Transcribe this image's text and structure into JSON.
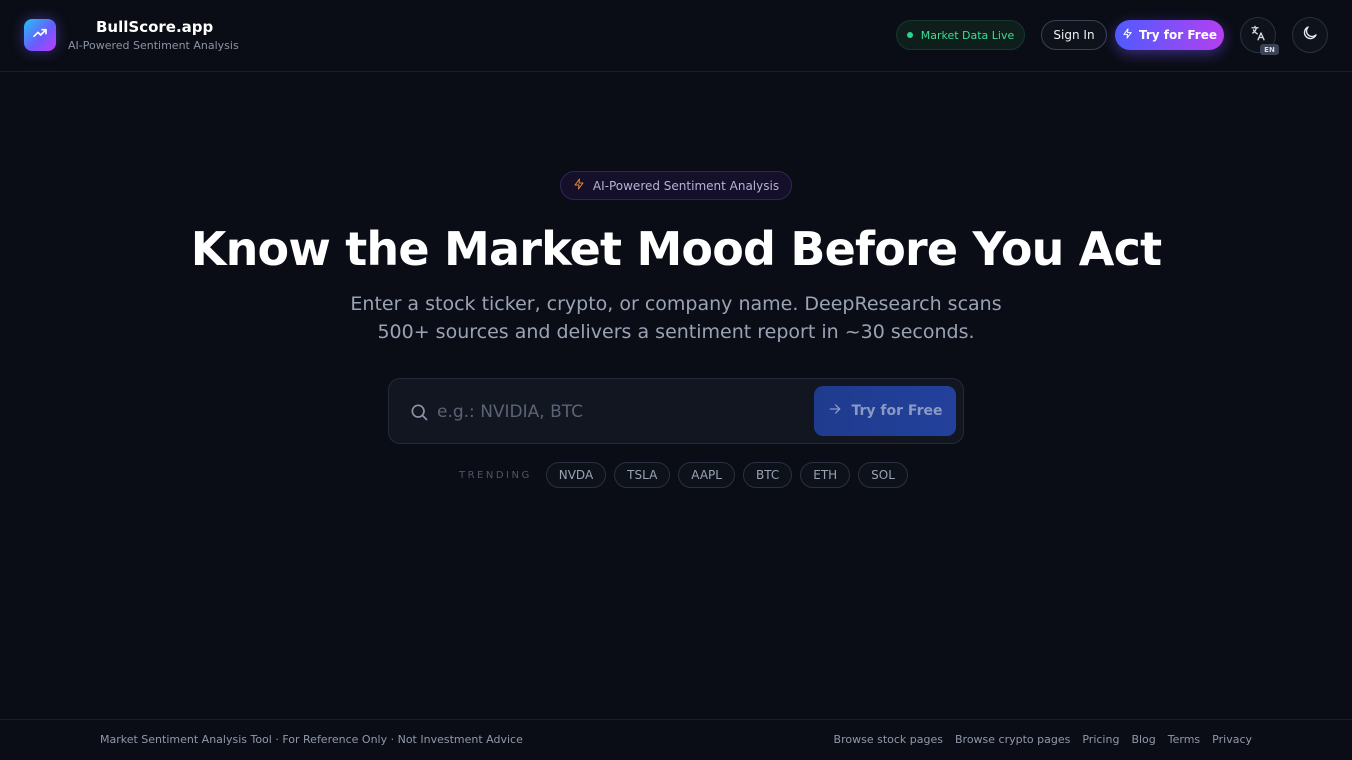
{
  "header": {
    "brand_name": "BullScore.app",
    "brand_tagline": "AI-Powered Sentiment Analysis",
    "market_status": "Market Data Live",
    "signin_label": "Sign In",
    "try_label": "Try for Free",
    "language_badge": "EN",
    "icons": {
      "logo": "trending-up-icon",
      "try": "lightning-icon",
      "language": "translate-icon",
      "theme": "moon-icon"
    }
  },
  "hero": {
    "badge_label": "AI-Powered Sentiment Analysis",
    "title": "Know the Market Mood Before You Act",
    "subtitle_line1": "Enter a stock ticker, crypto, or company name. DeepResearch scans",
    "subtitle_line2": "500+ sources and delivers a sentiment report in ~30 seconds."
  },
  "search": {
    "placeholder": "e.g.: NVIDIA, BTC",
    "value": "",
    "button_label": "Try for Free",
    "icons": {
      "search": "search-icon",
      "button": "arrow-right-icon"
    }
  },
  "trending": {
    "label": "TRENDING",
    "tickers": [
      "NVDA",
      "TSLA",
      "AAPL",
      "BTC",
      "ETH",
      "SOL"
    ]
  },
  "footer": {
    "note": "Market Sentiment Analysis Tool · For Reference Only · Not Investment Advice",
    "links": [
      "Browse stock pages",
      "Browse crypto pages",
      "Pricing",
      "Blog",
      "Terms",
      "Privacy"
    ]
  },
  "colors": {
    "background": "#0a0d15",
    "accent_gradient_start": "#4f5bff",
    "accent_gradient_end": "#b43ef0",
    "live_green": "#2fd48c",
    "search_button": "#23419c"
  }
}
